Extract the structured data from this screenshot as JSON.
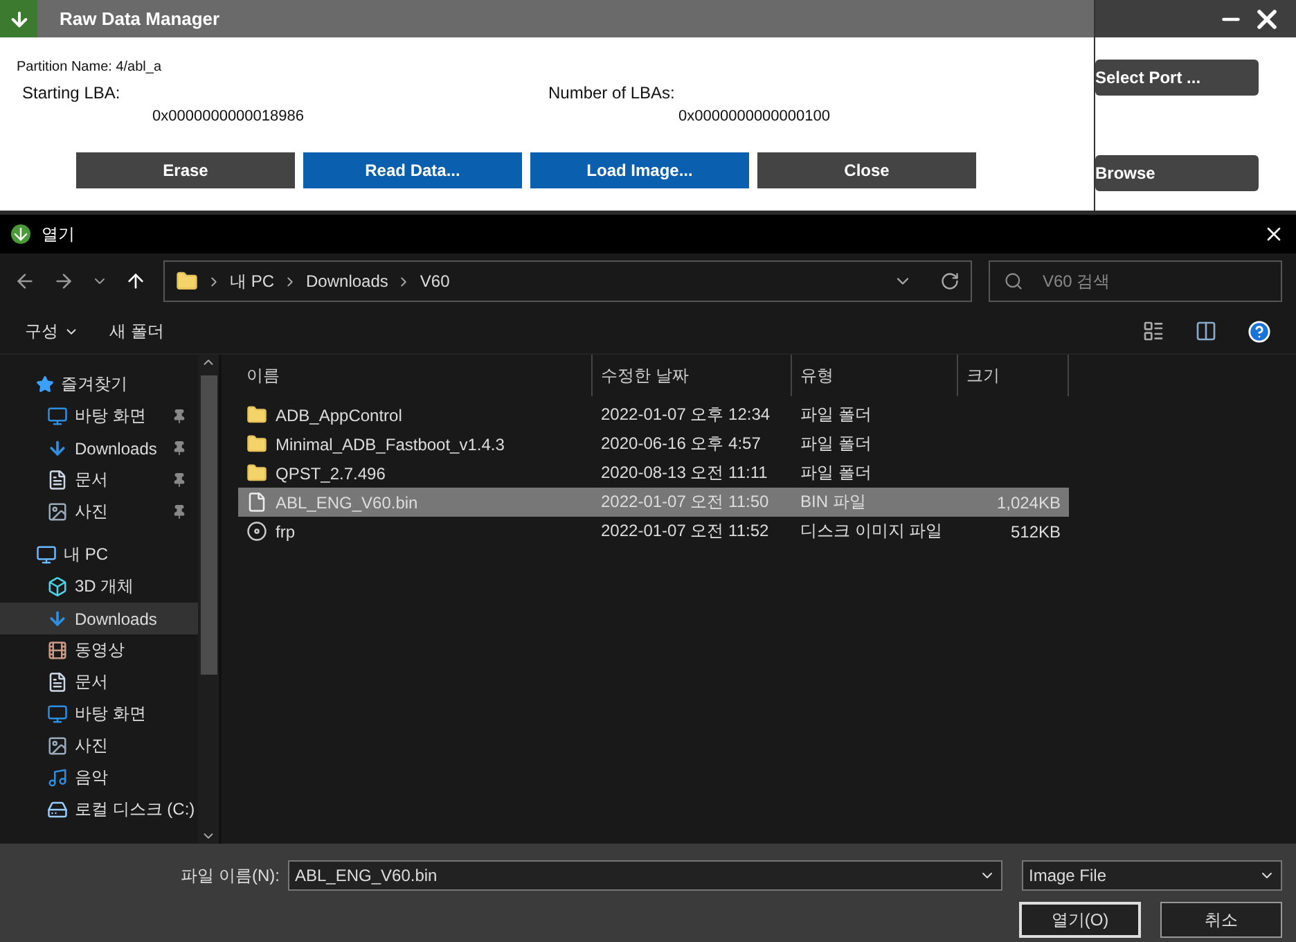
{
  "background_app": {
    "buttons": [
      {
        "label": "Select Port ..."
      },
      {
        "label": "Browse"
      }
    ]
  },
  "raw_data_manager": {
    "title": "Raw Data Manager",
    "partition_name": "Partition Name: 4/abl_a",
    "fields": [
      {
        "label": "Starting LBA:",
        "value": "0x0000000000018986"
      },
      {
        "label": "Number of LBAs:",
        "value": "0x0000000000000100"
      }
    ],
    "buttons": [
      {
        "label": "Erase",
        "kind": "plain"
      },
      {
        "label": "Read Data...",
        "kind": "primary"
      },
      {
        "label": "Load Image...",
        "kind": "primary"
      },
      {
        "label": "Close",
        "kind": "plain"
      }
    ]
  },
  "open_dialog": {
    "title": "열기",
    "breadcrumb": [
      "내 PC",
      "Downloads",
      "V60"
    ],
    "search": {
      "placeholder": "V60 검색"
    },
    "toolbar": [
      {
        "label": "구성",
        "dropdown": true
      },
      {
        "label": "새 폴더",
        "dropdown": false
      }
    ],
    "nav": [
      {
        "label": "즐겨찾기",
        "kind": "star",
        "selected": false,
        "children": [
          {
            "label": "바탕 화면",
            "kind": "desktop",
            "pinned": true,
            "selected": false
          },
          {
            "label": "Downloads",
            "kind": "download",
            "pinned": true,
            "selected": false
          },
          {
            "label": "문서",
            "kind": "document",
            "pinned": true,
            "selected": false
          },
          {
            "label": "사진",
            "kind": "picture",
            "pinned": true,
            "selected": false
          }
        ]
      },
      {
        "label": "내 PC",
        "kind": "pc",
        "selected": false,
        "children": [
          {
            "label": "3D 개체",
            "kind": "cube",
            "pinned": false,
            "selected": false
          },
          {
            "label": "Downloads",
            "kind": "download",
            "pinned": false,
            "selected": true
          },
          {
            "label": "동영상",
            "kind": "video",
            "pinned": false,
            "selected": false
          },
          {
            "label": "문서",
            "kind": "document",
            "pinned": false,
            "selected": false
          },
          {
            "label": "바탕 화면",
            "kind": "desktop",
            "pinned": false,
            "selected": false
          },
          {
            "label": "사진",
            "kind": "picture",
            "pinned": false,
            "selected": false
          },
          {
            "label": "음악",
            "kind": "music",
            "pinned": false,
            "selected": false
          },
          {
            "label": "로컬 디스크 (C:)",
            "kind": "drive",
            "pinned": false,
            "selected": false
          }
        ]
      }
    ],
    "columns": [
      "이름",
      "수정한 날짜",
      "유형",
      "크기"
    ],
    "rows": [
      {
        "name": "ADB_AppControl",
        "date": "2022-01-07 오후 12:34",
        "type": "파일 폴더",
        "kind": "folder",
        "selected": false
      },
      {
        "name": "Minimal_ADB_Fastboot_v1.4.3",
        "date": "2020-06-16 오후 4:57",
        "type": "파일 폴더",
        "kind": "folder",
        "selected": false
      },
      {
        "name": "QPST_2.7.496",
        "date": "2020-08-13 오전 11:11",
        "type": "파일 폴더",
        "kind": "folder",
        "selected": false
      },
      {
        "name": "ABL_ENG_V60.bin",
        "date": "2022-01-07 오전 11:50",
        "type": "BIN 파일",
        "size": "1,024KB",
        "kind": "file",
        "selected": true
      },
      {
        "name": "frp",
        "date": "2022-01-07 오전 11:52",
        "type": "디스크 이미지 파일",
        "size": "512KB",
        "kind": "disc",
        "selected": false
      }
    ],
    "file_name": {
      "label": "파일 이름(N):",
      "value": "ABL_ENG_V60.bin"
    },
    "file_type": "Image File",
    "buttons": [
      {
        "label": "열기(O)",
        "kind": "default"
      },
      {
        "label": "취소",
        "kind": "plain"
      }
    ]
  }
}
